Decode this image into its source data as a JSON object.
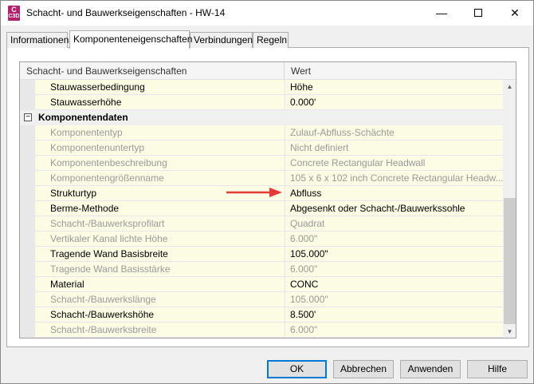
{
  "window": {
    "title": "Schacht- und Bauwerkseigenschaften - HW-14",
    "app_icon_letter": "C",
    "app_icon_sub": "C3D",
    "accent_color": "#b5206a"
  },
  "tabs": [
    {
      "label": "Informationen",
      "active": false
    },
    {
      "label": "Komponenteneigenschaften",
      "active": true
    },
    {
      "label": "Verbindungen",
      "active": false
    },
    {
      "label": "Regeln",
      "active": false
    }
  ],
  "grid": {
    "col_property": "Schacht- und Bauwerkseigenschaften",
    "col_value": "Wert",
    "category_label": "Komponentendaten",
    "category_expander": "−",
    "rows_before": [
      {
        "name": "Stauwasserbedingung",
        "value": "Höhe",
        "enabled": true
      },
      {
        "name": "Stauwasserhöhe",
        "value": "0.000'",
        "enabled": true
      }
    ],
    "rows_after": [
      {
        "name": "Komponententyp",
        "value": "Zulauf-Abfluss-Schächte",
        "enabled": false
      },
      {
        "name": "Komponentenuntertyp",
        "value": "Nicht definiert",
        "enabled": false
      },
      {
        "name": "Komponentenbeschreibung",
        "value": "Concrete Rectangular Headwall",
        "enabled": false
      },
      {
        "name": "Komponentengrößenname",
        "value": "105 x 6 x 102 inch Concrete Rectangular Headw...",
        "enabled": false
      },
      {
        "name": "Strukturtyp",
        "value": "Abfluss",
        "enabled": true
      },
      {
        "name": "Berme-Methode",
        "value": "Abgesenkt oder Schacht-/Bauwerkssohle",
        "enabled": true
      },
      {
        "name": "Schacht-/Bauwerksprofilart",
        "value": "Quadrat",
        "enabled": false
      },
      {
        "name": "Vertikaler Kanal lichte Höhe",
        "value": "6.000\"",
        "enabled": false
      },
      {
        "name": "Tragende Wand Basisbreite",
        "value": "105.000\"",
        "enabled": true
      },
      {
        "name": "Tragende Wand Basisstärke",
        "value": "6.000\"",
        "enabled": false
      },
      {
        "name": "Material",
        "value": "CONC",
        "enabled": true
      },
      {
        "name": "Schacht-/Bauwerkslänge",
        "value": "105.000\"",
        "enabled": false
      },
      {
        "name": "Schacht-/Bauwerkshöhe",
        "value": "8.500'",
        "enabled": true
      },
      {
        "name": "Schacht-/Bauwerksbreite",
        "value": "6.000\"",
        "enabled": false
      }
    ]
  },
  "buttons": {
    "ok": "OK",
    "cancel": "Abbrechen",
    "apply": "Anwenden",
    "help": "Hilfe"
  },
  "annotation_arrow_color": "#e53935"
}
